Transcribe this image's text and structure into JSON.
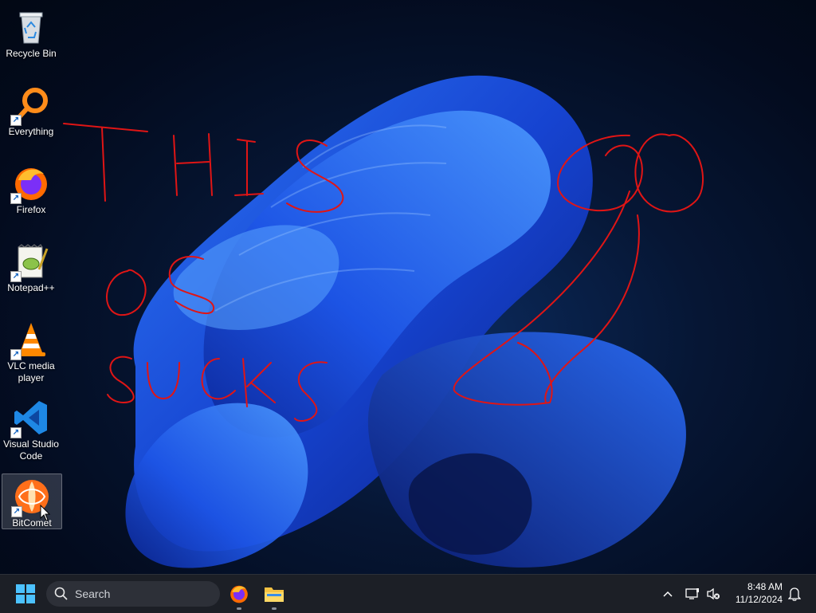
{
  "desktop": {
    "icons": [
      {
        "label": "Recycle Bin",
        "icon": "recycle-bin-icon"
      },
      {
        "label": "Everything",
        "icon": "everything-search-icon"
      },
      {
        "label": "Firefox",
        "icon": "firefox-icon"
      },
      {
        "label": "Notepad++",
        "icon": "notepad-plus-plus-icon"
      },
      {
        "label": "VLC media\nplayer",
        "icon": "vlc-cone-icon"
      },
      {
        "label": "Visual Studio\nCode",
        "icon": "vscode-icon"
      },
      {
        "label": "BitComet",
        "icon": "bitcomet-icon"
      }
    ],
    "annotation": {
      "text": "THIS OS SUCKS",
      "color": "#e01515"
    }
  },
  "taskbar": {
    "search_placeholder": "Search",
    "pinned": [
      "firefox-icon",
      "file-explorer-icon"
    ],
    "clock": {
      "time": "8:48 AM",
      "date": "11/12/2024"
    }
  },
  "colors": {
    "accent": "#1a73ff",
    "taskbar": "#1c1f26"
  }
}
